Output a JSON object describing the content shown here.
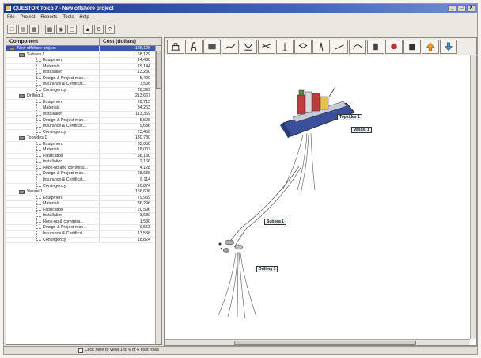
{
  "window": {
    "title": "QUESTOR Tolco 7 - New offshore project",
    "controls": [
      "_",
      "□",
      "X"
    ]
  },
  "menu": [
    "File",
    "Project",
    "Reports",
    "Tools",
    "Help"
  ],
  "tree": {
    "columns": [
      "Component",
      "Cost (dollars)"
    ],
    "rows": [
      {
        "level": 0,
        "name": "New offshore project",
        "value": "185,128",
        "selected": true
      },
      {
        "level": 1,
        "name": "Subsea 1",
        "value": "68,129"
      },
      {
        "level": 2,
        "name": "Equipment",
        "value": "14,480"
      },
      {
        "level": 2,
        "name": "Materials",
        "value": "15,144"
      },
      {
        "level": 2,
        "name": "Installation",
        "value": "13,280"
      },
      {
        "level": 2,
        "name": "Design & Project man...",
        "value": "5,400"
      },
      {
        "level": 2,
        "name": "Insurance & Certificat...",
        "value": "7,506"
      },
      {
        "level": 2,
        "name": "Contingency",
        "value": "28,399"
      },
      {
        "level": 1,
        "name": "Drilling 1",
        "value": "213,667"
      },
      {
        "level": 2,
        "name": "Equipment",
        "value": "28,715"
      },
      {
        "level": 2,
        "name": "Materials",
        "value": "34,263"
      },
      {
        "level": 2,
        "name": "Installation",
        "value": "113,369"
      },
      {
        "level": 2,
        "name": "Design & Project man...",
        "value": "5,508"
      },
      {
        "level": 2,
        "name": "Insurance & Certificat...",
        "value": "9,686"
      },
      {
        "level": 2,
        "name": "Contingency",
        "value": "25,458"
      },
      {
        "level": 1,
        "name": "Topsides 1",
        "value": "130,730"
      },
      {
        "level": 2,
        "name": "Equipment",
        "value": "32,058"
      },
      {
        "level": 2,
        "name": "Materials",
        "value": "18,007"
      },
      {
        "level": 2,
        "name": "Fabrication",
        "value": "38,130"
      },
      {
        "level": 2,
        "name": "Installation",
        "value": "2,166"
      },
      {
        "level": 2,
        "name": "Hook-up and commiss...",
        "value": "4,128"
      },
      {
        "level": 2,
        "name": "Design & Project man...",
        "value": "28,638"
      },
      {
        "level": 2,
        "name": "Insurance & Certificat...",
        "value": "8,114"
      },
      {
        "level": 2,
        "name": "Contingency",
        "value": "16,874"
      },
      {
        "level": 1,
        "name": "Vessel 1",
        "value": "156,606"
      },
      {
        "level": 2,
        "name": "Equipment",
        "value": "79,959"
      },
      {
        "level": 2,
        "name": "Materials",
        "value": "36,296"
      },
      {
        "level": 2,
        "name": "Fabrication",
        "value": "20,596"
      },
      {
        "level": 2,
        "name": "Installation",
        "value": "3,680"
      },
      {
        "level": 2,
        "name": "Hook-up & commiss...",
        "value": "1,580"
      },
      {
        "level": 2,
        "name": "Design & Project man...",
        "value": "9,563"
      },
      {
        "level": 2,
        "name": "Insurance & Certificat...",
        "value": "13,538"
      },
      {
        "level": 2,
        "name": "Contingency",
        "value": "18,824"
      }
    ]
  },
  "palette": [
    "platform-icon",
    "jacket-icon",
    "topsides-icon",
    "pipeline-icon",
    "riser-icon",
    "riser-bundle-icon",
    "well-icon",
    "template-icon",
    "tower-icon",
    "flowline-icon",
    "umbilical-icon",
    "buoy-icon",
    "rig-icon",
    "turret-icon",
    "arrow-up-icon",
    "arrow-down-icon"
  ],
  "canvas_labels": {
    "topsides": "Topsides 1",
    "vessel": "Vessel 1",
    "subsea": "Subsea 1",
    "drilling": "Drilling 1"
  },
  "status": {
    "hint": "Click here to view 1 to 6 of 6 cost rows"
  },
  "colors": {
    "title_bar": "#1d3a8a",
    "selection": "#3a5aa8",
    "vessel_hull": "#3a4f9a",
    "topsides": "#c23b3b"
  }
}
